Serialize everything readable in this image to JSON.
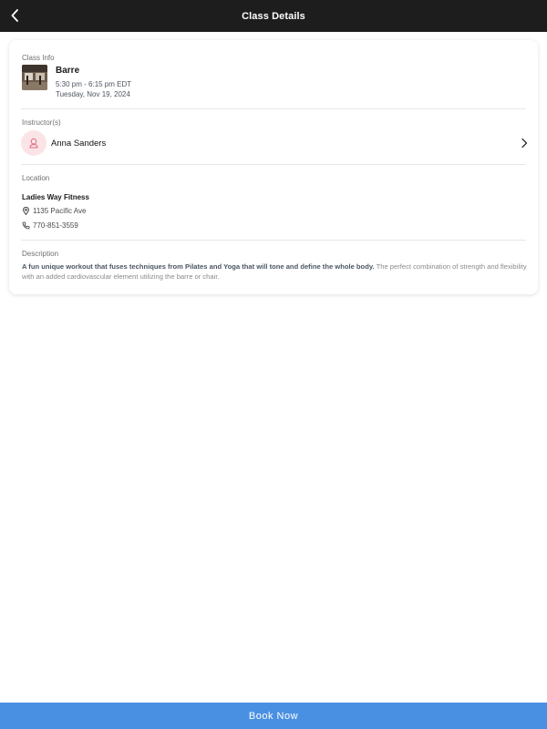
{
  "header": {
    "title": "Class Details",
    "back_icon": "chevron-left-icon"
  },
  "class_info": {
    "section_label": "Class Info",
    "name": "Barre",
    "time": "5:30 pm - 6:15 pm EDT",
    "date": "Tuesday, Nov 19, 2024"
  },
  "instructor": {
    "section_label": "Instructor(s)",
    "name": "Anna Sanders",
    "avatar_icon": "user-icon",
    "avatar_bg": "#fbe4e7",
    "avatar_fg": "#e26a7f"
  },
  "location": {
    "section_label": "Location",
    "name": "Ladies Way Fitness",
    "address": "1135 Pacific Ave",
    "phone": "770-851-3559"
  },
  "description": {
    "section_label": "Description",
    "highlight": "A fun unique workout that fuses techniques from Pilates and Yoga that will tone and define the whole body.",
    "body": " The perfect combination of strength and flexibility with an added cardiovascular element utilizing the barre or chair."
  },
  "footer": {
    "book_label": "Book Now",
    "accent": "#4a90e2"
  }
}
